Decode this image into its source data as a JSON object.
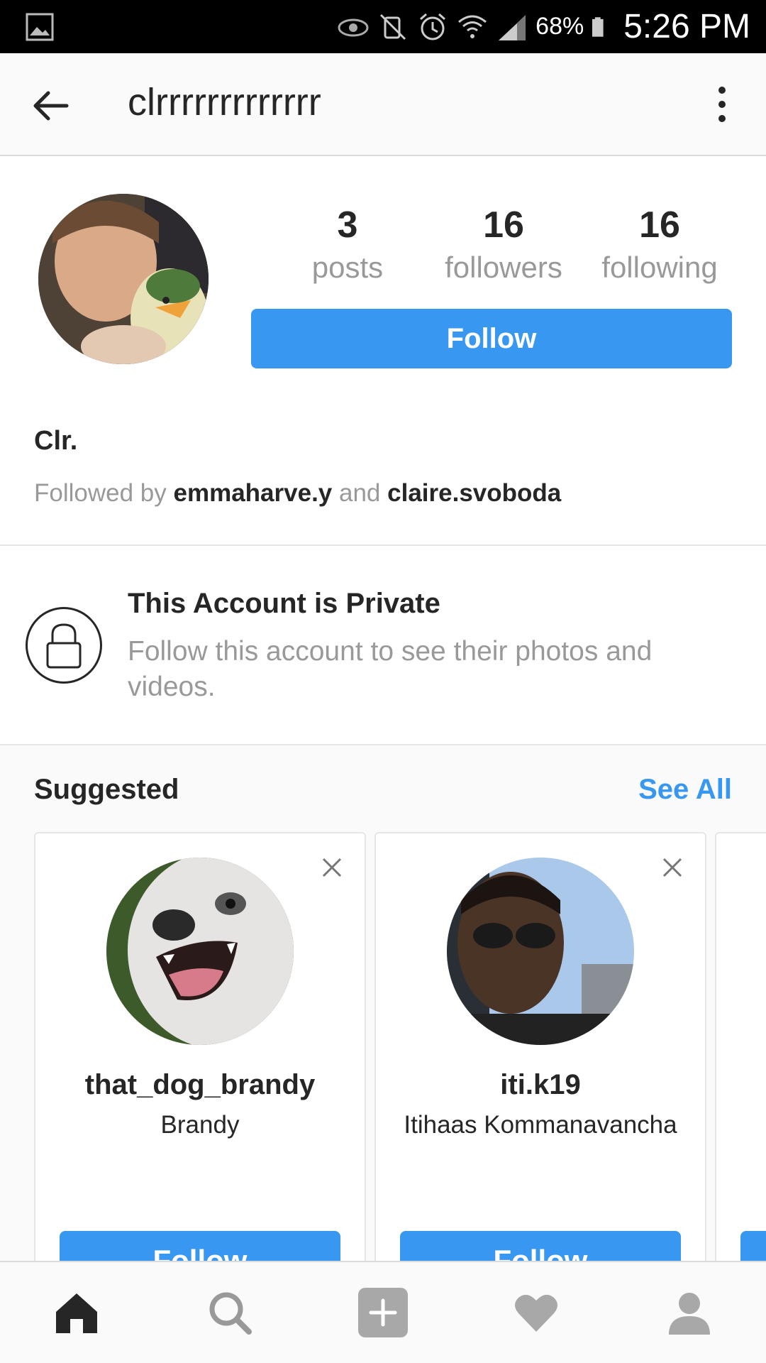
{
  "status_bar": {
    "battery_percent": "68%",
    "time": "5:26 PM",
    "icons": [
      "gallery-icon",
      "eye-icon",
      "mute-icon",
      "alarm-icon",
      "wifi-icon",
      "signal-icon",
      "battery-icon"
    ]
  },
  "header": {
    "username": "clrrrrrrrrrrrrr"
  },
  "profile": {
    "stats": [
      {
        "value": "3",
        "label": "posts"
      },
      {
        "value": "16",
        "label": "followers"
      },
      {
        "value": "16",
        "label": "following"
      }
    ],
    "follow_label": "Follow",
    "display_name": "Clr.",
    "followed_by_prefix": "Followed by",
    "followed_by_conjunction": "and",
    "followed_by_accounts": [
      "emmaharve.y",
      "claire.svoboda"
    ]
  },
  "private_notice": {
    "title": "This Account is Private",
    "description": "Follow this account to see their photos and videos."
  },
  "suggested": {
    "title": "Suggested",
    "see_all_label": "See All",
    "cards": [
      {
        "username": "that_dog_brandy",
        "name": "Brandy",
        "follow_label": "Follow"
      },
      {
        "username": "iti.k19",
        "name": "Itihaas Kommanavancha",
        "follow_label": "Follow"
      }
    ]
  },
  "bottom_nav": [
    "home-icon",
    "search-icon",
    "add-post-icon",
    "activity-heart-icon",
    "profile-icon"
  ],
  "colors": {
    "accent": "#3897f0",
    "text": "#262626",
    "muted": "#999999",
    "status_bar": "#000000"
  }
}
